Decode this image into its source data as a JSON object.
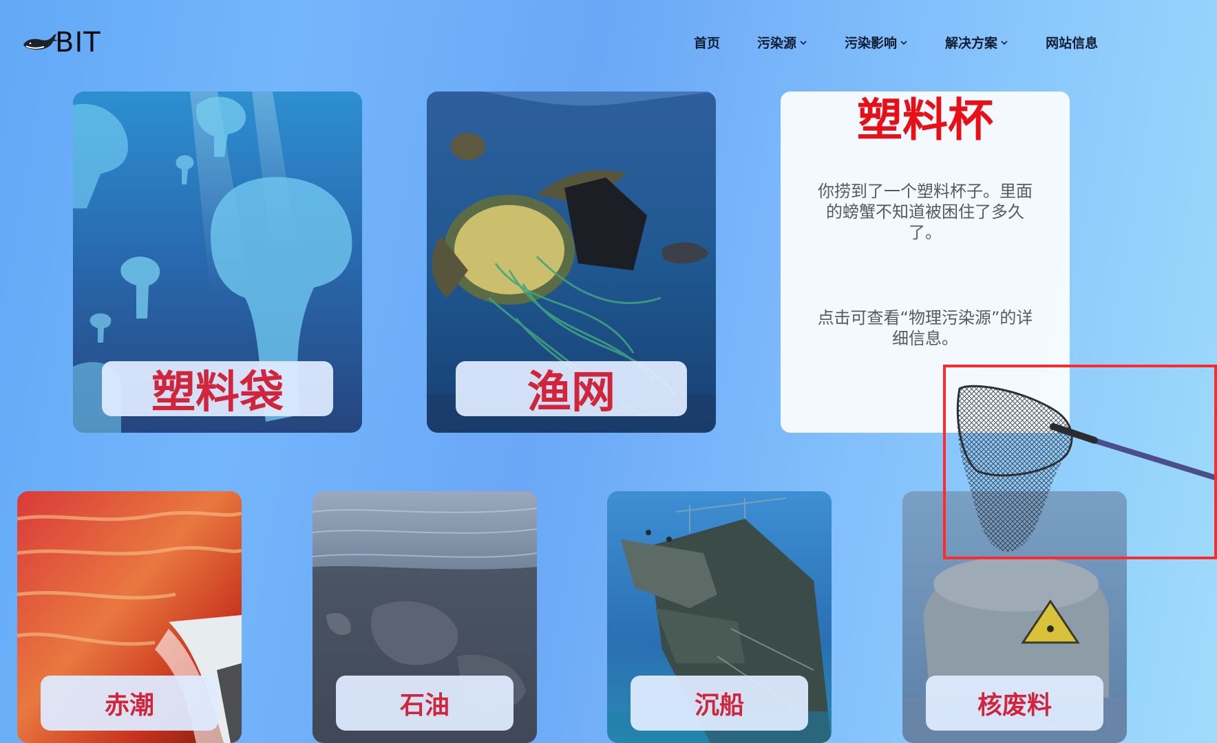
{
  "header": {
    "logo_text": "BIT",
    "logo_icon": "whale-icon",
    "nav": [
      {
        "label": "首页",
        "has_dropdown": false
      },
      {
        "label": "污染源",
        "has_dropdown": true
      },
      {
        "label": "污染影响",
        "has_dropdown": true
      },
      {
        "label": "解决方案",
        "has_dropdown": true
      },
      {
        "label": "网站信息",
        "has_dropdown": false
      }
    ]
  },
  "top_cards": [
    {
      "label": "塑料袋",
      "image": "plastic-bag-jellyfish"
    },
    {
      "label": "渔网",
      "image": "turtle-in-fishing-net"
    }
  ],
  "info_card": {
    "title": "塑料杯",
    "description": "你捞到了一个塑料杯子。里面的螃蟹不知道被困住了多久了。",
    "link_text": "点击可查看“物理污染源”的详细信息。"
  },
  "bottom_cards": [
    {
      "label": "赤潮",
      "image": "red-tide-waves"
    },
    {
      "label": "石油",
      "image": "oil-covered-beach"
    },
    {
      "label": "沉船",
      "image": "shipwreck"
    },
    {
      "label": "核废料",
      "image": "nuclear-waste-barrel"
    }
  ],
  "cursor": {
    "icon": "fishing-net-icon"
  },
  "colors": {
    "label_text": "#d0253a",
    "info_title": "#e80f17",
    "highlight_border": "#ff2a2a",
    "nav_text": "#0f1d33"
  }
}
